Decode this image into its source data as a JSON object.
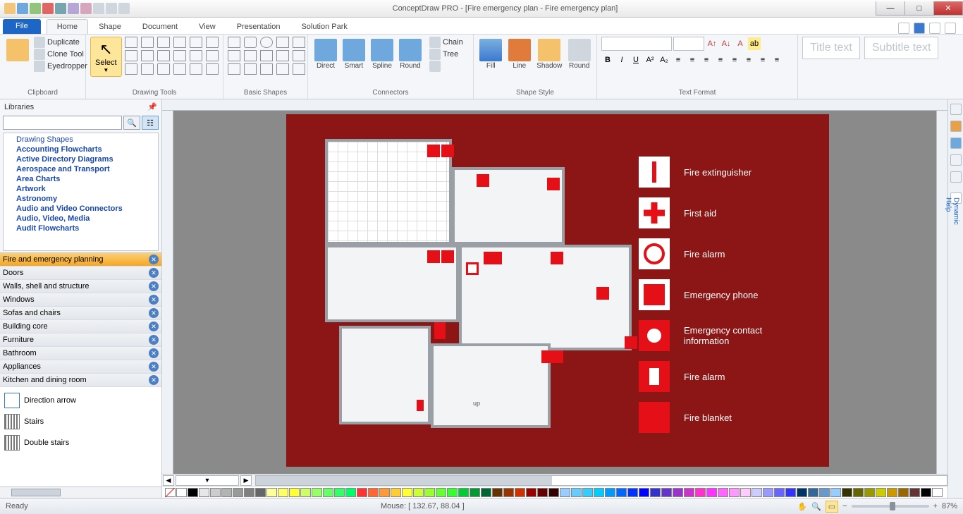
{
  "title": "ConceptDraw PRO - [Fire emergency plan - Fire emergency plan]",
  "menu": {
    "file": "File",
    "tabs": [
      "Home",
      "Shape",
      "Document",
      "View",
      "Presentation",
      "Solution Park"
    ],
    "active": 0
  },
  "ribbon": {
    "clipboard": {
      "label": "Clipboard",
      "items": [
        "Duplicate",
        "Clone Tool",
        "Eyedropper"
      ]
    },
    "drawing": {
      "label": "Drawing Tools",
      "select": "Select"
    },
    "basic": {
      "label": "Basic Shapes"
    },
    "connectors": {
      "label": "Connectors",
      "items": [
        "Direct",
        "Smart",
        "Spline",
        "Round"
      ],
      "side": [
        "Chain",
        "Tree"
      ]
    },
    "shapestyle": {
      "label": "Shape Style",
      "items": [
        "Fill",
        "Line",
        "Shadow",
        "Round"
      ]
    },
    "textformat": {
      "label": "Text Format"
    },
    "title_ph": "Title text",
    "subtitle_ph": "Subtitle text"
  },
  "libraries": {
    "title": "Libraries",
    "tree": [
      "Drawing Shapes",
      "Accounting Flowcharts",
      "Active Directory Diagrams",
      "Aerospace and Transport",
      "Area Charts",
      "Artwork",
      "Astronomy",
      "Audio and Video Connectors",
      "Audio, Video, Media",
      "Audit Flowcharts"
    ],
    "cats": [
      "Fire and emergency planning",
      "Doors",
      "Walls, shell and structure",
      "Windows",
      "Sofas and chairs",
      "Building core",
      "Furniture",
      "Bathroom",
      "Appliances",
      "Kitchen and dining room"
    ],
    "active_cat": 0,
    "stencils": [
      "Direction arrow",
      "Stairs",
      "Double stairs"
    ]
  },
  "legend": [
    "Fire extinguisher",
    "First aid",
    "Fire alarm",
    "Emergency phone",
    "Emergency contact information",
    "Fire alarm",
    "Fire blanket"
  ],
  "palette": [
    "#ffffff",
    "#000000",
    "#e6e6e6",
    "#cccccc",
    "#b3b3b3",
    "#999999",
    "#808080",
    "#666666",
    "#ffff99",
    "#ffff66",
    "#ffff33",
    "#ccff66",
    "#99ff66",
    "#66ff66",
    "#33ff66",
    "#00ff66",
    "#ff3333",
    "#ff6633",
    "#ff9933",
    "#ffcc33",
    "#ffff33",
    "#ccff33",
    "#99ff33",
    "#66ff33",
    "#33ff33",
    "#00cc33",
    "#009933",
    "#006633",
    "#663300",
    "#993300",
    "#cc3300",
    "#990000",
    "#660000",
    "#330000",
    "#99ccff",
    "#66ccff",
    "#33ccff",
    "#00ccff",
    "#0099ff",
    "#0066ff",
    "#0033ff",
    "#0000ff",
    "#3333cc",
    "#6633cc",
    "#9933cc",
    "#cc33cc",
    "#ff33cc",
    "#ff33ff",
    "#ff66ff",
    "#ff99ff",
    "#ffccff",
    "#ccccff",
    "#9999ff",
    "#6666ff",
    "#3333ff",
    "#003366",
    "#336699",
    "#6699cc",
    "#99ccff",
    "#333300",
    "#666600",
    "#999900",
    "#cccc00",
    "#cc9900",
    "#996600",
    "#663333",
    "#000000",
    "#ffffff"
  ],
  "status": {
    "ready": "Ready",
    "mouse": "Mouse: [ 132.67, 88.04 ]",
    "zoom": "87%"
  }
}
